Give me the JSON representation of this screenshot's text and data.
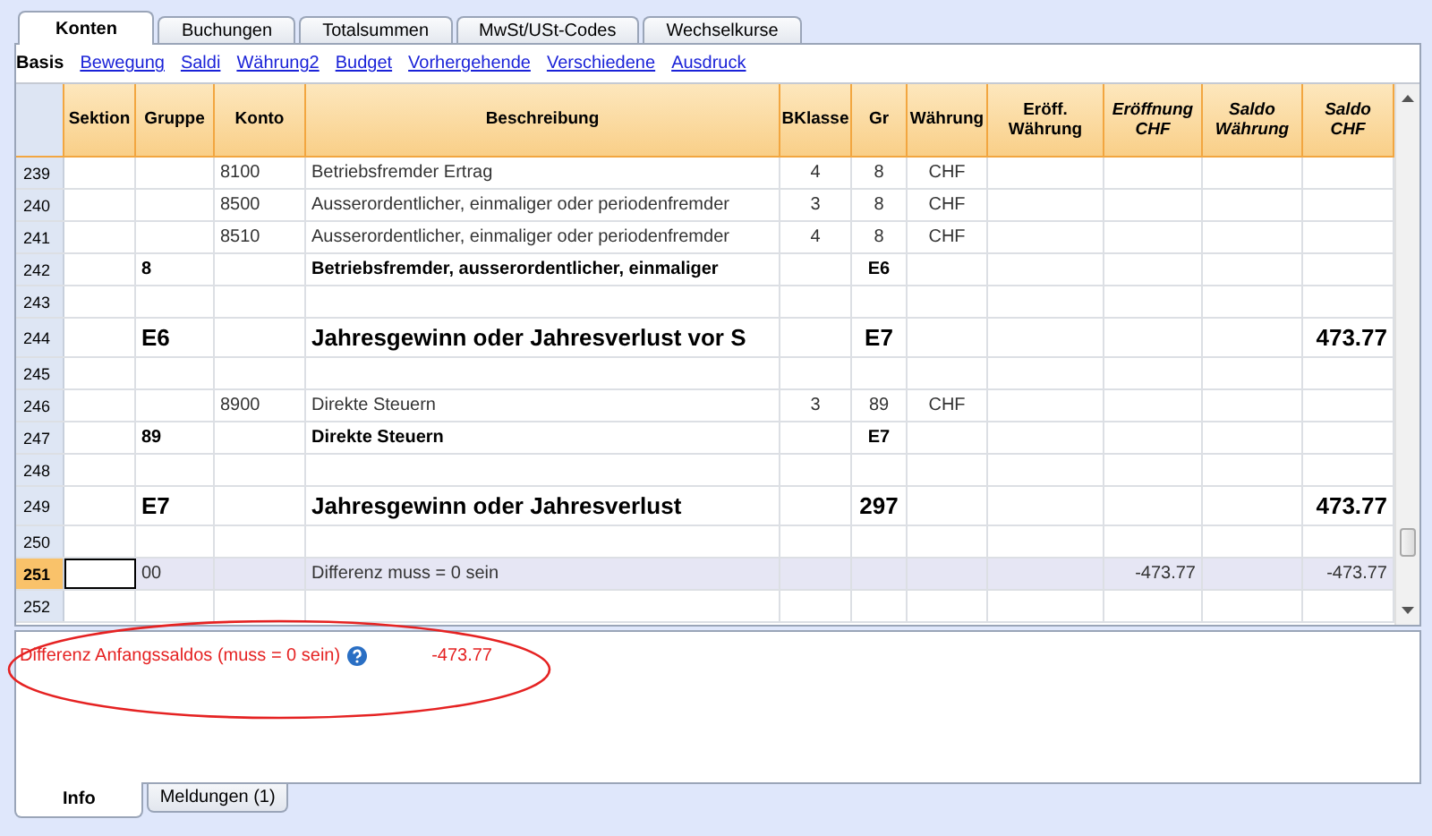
{
  "tabs": [
    {
      "label": "Konten",
      "selected": true
    },
    {
      "label": "Buchungen",
      "selected": false
    },
    {
      "label": "Totalsummen",
      "selected": false
    },
    {
      "label": "MwSt/USt-Codes",
      "selected": false
    },
    {
      "label": "Wechselkurse",
      "selected": false
    }
  ],
  "views": [
    {
      "label": "Basis",
      "selected": true
    },
    {
      "label": "Bewegung",
      "selected": false
    },
    {
      "label": "Saldi",
      "selected": false
    },
    {
      "label": "Währung2",
      "selected": false
    },
    {
      "label": "Budget",
      "selected": false
    },
    {
      "label": "Vorhergehende",
      "selected": false
    },
    {
      "label": "Verschiedene",
      "selected": false
    },
    {
      "label": "Ausdruck",
      "selected": false
    }
  ],
  "table": {
    "columns": [
      {
        "label": "Sektion",
        "italic": false
      },
      {
        "label": "Gruppe",
        "italic": false
      },
      {
        "label": "Konto",
        "italic": false
      },
      {
        "label": "Beschreibung",
        "italic": false
      },
      {
        "label": "BKlasse",
        "italic": false
      },
      {
        "label": "Gr",
        "italic": false
      },
      {
        "label": "Währung",
        "italic": false
      },
      {
        "label": "Eröff.\nWährung",
        "italic": false
      },
      {
        "label": "Eröffnung\nCHF",
        "italic": true
      },
      {
        "label": "Saldo\nWährung",
        "italic": true
      },
      {
        "label": "Saldo\nCHF",
        "italic": true
      }
    ],
    "rows": [
      {
        "number": "239",
        "kind": "account",
        "selected": false,
        "cells": {
          "konto": "8100",
          "beschreibung": "Betriebsfremder Ertrag",
          "bklasse": "4",
          "gr": "8",
          "waehrung": "CHF"
        }
      },
      {
        "number": "240",
        "kind": "account",
        "selected": false,
        "cells": {
          "konto": "8500",
          "beschreibung": "Ausserordentlicher, einmaliger oder periodenfremder",
          "bklasse": "3",
          "gr": "8",
          "waehrung": "CHF"
        }
      },
      {
        "number": "241",
        "kind": "account",
        "selected": false,
        "cells": {
          "konto": "8510",
          "beschreibung": "Ausserordentlicher, einmaliger oder periodenfremder",
          "bklasse": "4",
          "gr": "8",
          "waehrung": "CHF"
        }
      },
      {
        "number": "242",
        "kind": "group",
        "selected": false,
        "cells": {
          "gruppe": "8",
          "beschreibung": "Betriebsfremder, ausserordentlicher, einmaliger",
          "gr": "E6"
        }
      },
      {
        "number": "243",
        "kind": "empty",
        "selected": false,
        "cells": {}
      },
      {
        "number": "244",
        "kind": "total",
        "selected": false,
        "cells": {
          "gruppe": "E6",
          "beschreibung": "Jahresgewinn oder Jahresverlust vor S",
          "gr": "E7",
          "saldo_chf": "473.77"
        }
      },
      {
        "number": "245",
        "kind": "empty",
        "selected": false,
        "cells": {}
      },
      {
        "number": "246",
        "kind": "account",
        "selected": false,
        "cells": {
          "konto": "8900",
          "beschreibung": "Direkte Steuern",
          "bklasse": "3",
          "gr": "89",
          "waehrung": "CHF"
        }
      },
      {
        "number": "247",
        "kind": "group",
        "selected": false,
        "cells": {
          "gruppe": "89",
          "beschreibung": "Direkte Steuern",
          "gr": "E7"
        }
      },
      {
        "number": "248",
        "kind": "empty",
        "selected": false,
        "cells": {}
      },
      {
        "number": "249",
        "kind": "total",
        "selected": false,
        "cells": {
          "gruppe": "E7",
          "beschreibung": "Jahresgewinn oder Jahresverlust",
          "gr": "297",
          "saldo_chf": "473.77"
        }
      },
      {
        "number": "250",
        "kind": "empty",
        "selected": false,
        "cells": {}
      },
      {
        "number": "251",
        "kind": "account",
        "selected": true,
        "cells": {
          "gruppe": "00",
          "beschreibung": "Differenz muss = 0 sein",
          "eroeffnung_chf": "-473.77",
          "saldo_chf": "-473.77"
        }
      },
      {
        "number": "252",
        "kind": "empty",
        "selected": false,
        "cells": {}
      }
    ]
  },
  "info": {
    "label": "Differenz Anfangssaldos (muss = 0 sein)",
    "value": "-473.77"
  },
  "bottom_tabs": [
    {
      "label": "Info",
      "selected": true
    },
    {
      "label": "Meldungen (1)",
      "selected": false
    }
  ]
}
